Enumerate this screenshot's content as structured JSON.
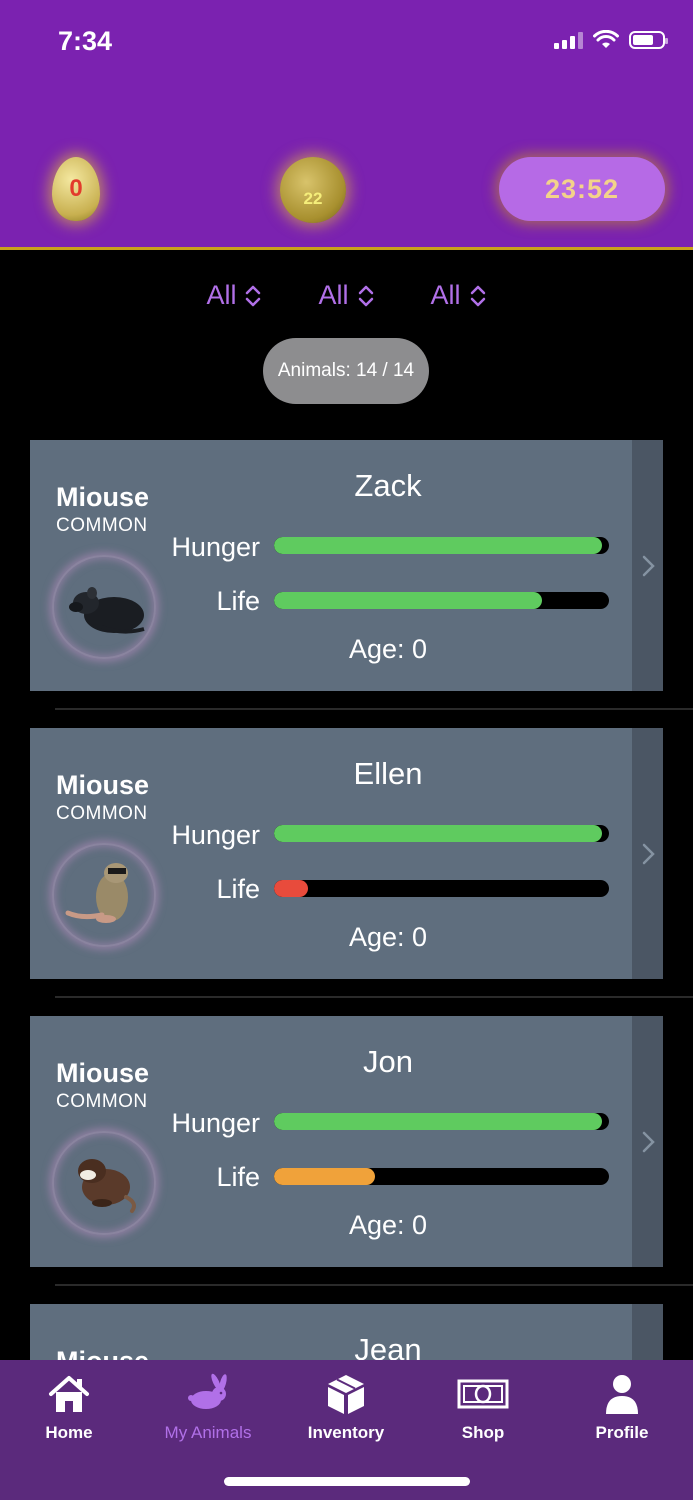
{
  "status_bar": {
    "time": "7:34"
  },
  "header": {
    "egg_count": "0",
    "coin_count": "22",
    "timer": "23:52"
  },
  "filters": [
    {
      "label": "All"
    },
    {
      "label": "All"
    },
    {
      "label": "All"
    }
  ],
  "animals_count": "Animals: 14 / 14",
  "stat_labels": {
    "hunger": "Hunger",
    "life": "Life"
  },
  "animals": [
    {
      "species": "Miouse",
      "rarity": "COMMON",
      "name": "Zack",
      "hunger": 0.98,
      "life": 0.8,
      "life_color": "#5fcb5f",
      "age": "Age: 0",
      "icon": "black-mouse-icon"
    },
    {
      "species": "Miouse",
      "rarity": "COMMON",
      "name": "Ellen",
      "hunger": 0.98,
      "life": 0.1,
      "life_color": "#e84b3c",
      "age": "Age: 0",
      "icon": "tan-mouse-icon"
    },
    {
      "species": "Miouse",
      "rarity": "COMMON",
      "name": "Jon",
      "hunger": 0.98,
      "life": 0.3,
      "life_color": "#f0a23a",
      "age": "Age: 0",
      "icon": "brown-mouse-icon"
    },
    {
      "species": "Miouse",
      "rarity": "",
      "name": "Jean"
    }
  ],
  "colors": {
    "hunger": "#5fcb5f",
    "accent": "#b170e8",
    "header": "#7b22b0",
    "tabbar": "#5b2a7c"
  },
  "tabs": [
    {
      "label": "Home",
      "icon": "home-icon"
    },
    {
      "label": "My Animals",
      "icon": "rabbit-icon",
      "active": true
    },
    {
      "label": "Inventory",
      "icon": "box-icon"
    },
    {
      "label": "Shop",
      "icon": "banknote-icon"
    },
    {
      "label": "Profile",
      "icon": "person-icon"
    }
  ]
}
